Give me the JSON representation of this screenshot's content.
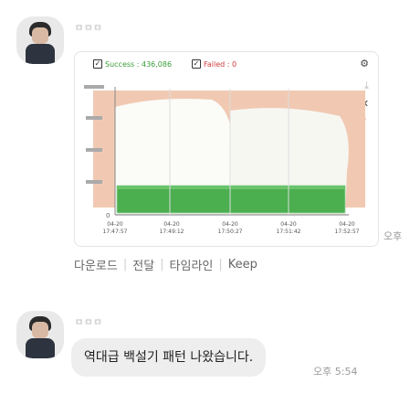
{
  "messages": [
    {
      "sender_name": "ㅁㅁㅁ",
      "chart_card": {
        "legend": [
          {
            "label": "Success : 436,086",
            "color": "#3a9c3a",
            "checked": true
          },
          {
            "label": "Failed : 0",
            "color": "#d23b3b",
            "checked": true
          }
        ],
        "toolbar": {
          "settings_icon": "gear-icon",
          "download_icon": "download-icon",
          "close_icon": "close-icon",
          "help_icon": "question-icon"
        },
        "chart_data": {
          "type": "area",
          "x": [
            "04-20\n17:47:57",
            "04-20\n17:49:12",
            "04-20\n17:50:27",
            "04-20\n17:51:42",
            "04-20\n17:52:57"
          ],
          "series": [
            {
              "name": "Success",
              "color": "#3fa83f"
            }
          ],
          "y_ticks": [
            "0"
          ]
        }
      },
      "time": "오후"
    },
    {
      "sender_name": "ㅁㅁㅁ",
      "text": "역대급 백설기 패턴 나왔습니다.",
      "time": "오후 5:54"
    }
  ],
  "actions": [
    "다운로드",
    "전달",
    "타임라인",
    "Keep"
  ]
}
